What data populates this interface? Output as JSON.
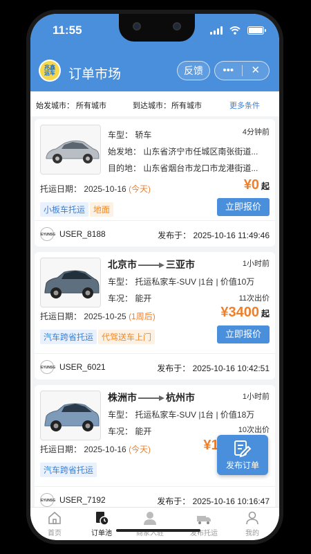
{
  "status": {
    "time": "11:55"
  },
  "header": {
    "title": "订单市场",
    "feedback": "反馈",
    "more": "•••",
    "close": "✕",
    "logo_text": "兆鑫\n运车"
  },
  "filter": {
    "origin_label": "始发城市：",
    "origin_value": "所有城市",
    "dest_label": "到达城市：",
    "dest_value": "所有城市",
    "more": "更多条件"
  },
  "orders": [
    {
      "car_type": "车型：  轿车",
      "time_ago": "4分钟前",
      "from": "始发地：  山东省济宁市任城区南张街道...",
      "to": "目的地：  山东省烟台市龙口市龙港街道...",
      "date_label": "托运日期：  2025-10-16",
      "date_note": "(今天)",
      "price": "¥0",
      "price_suffix": "起",
      "tags": [
        "小板车托运",
        "地面"
      ],
      "quote": "立即报价",
      "user": "USER_8188",
      "posted": "发布于：  2025-10-16 11:49:46"
    },
    {
      "route_from": "北京市",
      "route_to": "三亚市",
      "time_ago": "1小时前",
      "car_type": "车型：  托运私家车-SUV  |1台 | 价值10万",
      "condition": "车况：  能开",
      "bids": "11次出价",
      "date_label": "托运日期：  2025-10-25",
      "date_note": "(1周后)",
      "price": "¥3400",
      "price_suffix": "起",
      "tags": [
        "汽车跨省托运",
        "代驾送车上门"
      ],
      "quote": "立即报价",
      "user": "USER_6021",
      "posted": "发布于：  2025-10-16 10:42:51"
    },
    {
      "route_from": "株洲市",
      "route_to": "杭州市",
      "time_ago": "1小时前",
      "car_type": "车型：  托运私家车-SUV  |1台 | 价值18万",
      "condition": "车况：  能开",
      "bids": "10次出价",
      "date_label": "托运日期：  2025-10-16",
      "date_note": "(今天)",
      "price": "¥1500",
      "tags": [
        "汽车跨省托运"
      ],
      "user": "USER_7192",
      "posted": "发布于：  2025-10-16 10:16:47"
    }
  ],
  "fab": {
    "label": "发布订单"
  },
  "tabs": [
    {
      "label": "首页",
      "icon": "home-icon"
    },
    {
      "label": "订单池",
      "icon": "order-pool-icon"
    },
    {
      "label": "商家入驻",
      "icon": "merchant-icon"
    },
    {
      "label": "发布托运",
      "icon": "truck-icon"
    },
    {
      "label": "我的",
      "icon": "profile-icon"
    }
  ],
  "colors": {
    "primary": "#4a8fdc",
    "accent": "#f07f2a",
    "tag_blue_bg": "#e9f1fd",
    "tag_orange_bg": "#fdf1e3"
  }
}
